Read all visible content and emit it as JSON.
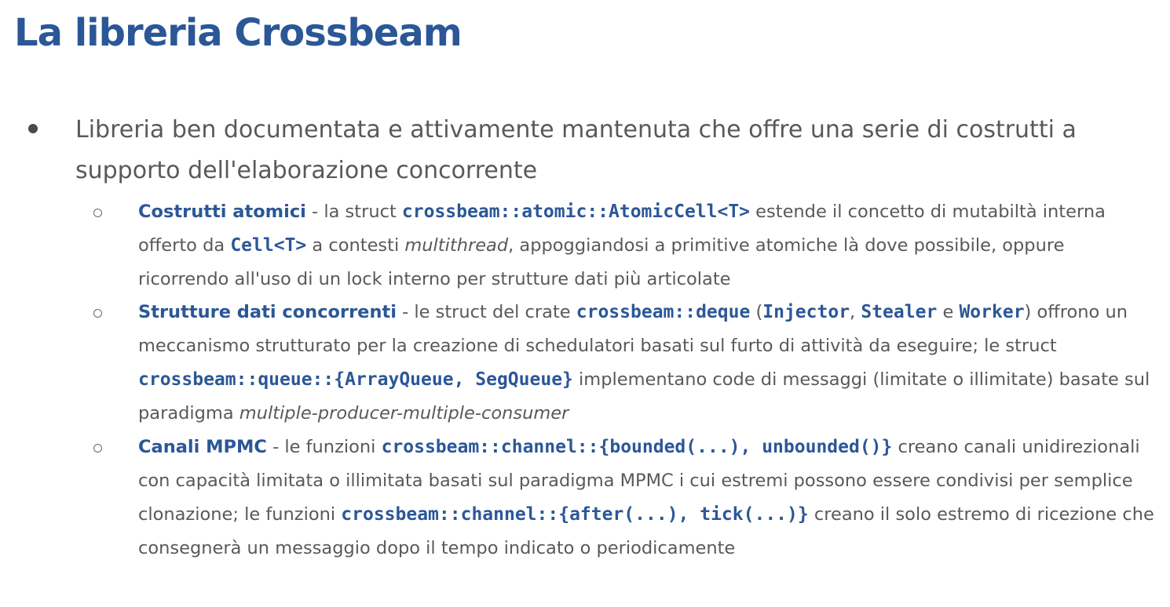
{
  "slide": {
    "title": "La libreria Crossbeam",
    "main_bullet": "Libreria ben documentata e attivamente mantenuta che offre una serie di costrutti a supporto dell'elaborazione concorrente",
    "items": [
      {
        "heading": "Costrutti atomici",
        "t1": " - la struct ",
        "c1": "crossbeam::atomic::AtomicCell<T>",
        "t2": " estende il concetto di mutabiltà interna offerto da ",
        "c2": "Cell<T>",
        "t3": " a contesti ",
        "em1": "multithread",
        "t4": ", appoggiandosi a primitive atomiche là dove possibile, oppure ricorrendo all'uso di un lock interno per strutture dati più articolate"
      },
      {
        "heading": "Strutture dati concorrenti",
        "t1": " - le struct del crate ",
        "c1": "crossbeam::deque",
        "t2": " (",
        "c2": "Injector",
        "t3": ", ",
        "c3": "Stealer",
        "t4": " e ",
        "c4": "Worker",
        "t5": ") offrono un meccanismo strutturato per la creazione di schedulatori basati sul furto di attività da eseguire; le struct ",
        "c5": "crossbeam::queue::{ArrayQueue, SegQueue}",
        "t6": " implementano code di messaggi (limitate o illimitate) basate sul paradigma ",
        "em1": "multiple-producer-multiple-consumer"
      },
      {
        "heading": "Canali MPMC",
        "t1": " - le funzioni ",
        "c1": "crossbeam::channel::{bounded(...), unbounded()}",
        "t2": " creano canali unidirezionali con capacità limitata o illimitata basati sul paradigma MPMC i cui estremi possono essere condivisi per semplice clonazione; le funzioni ",
        "c2": "crossbeam::channel::{after(...), tick(...)}",
        "t3": " creano il solo estremo di ricezione che consegnerà un messaggio dopo il tempo indicato o periodicamente"
      }
    ]
  },
  "colors": {
    "accent": "#2b5797",
    "text": "#595959"
  }
}
